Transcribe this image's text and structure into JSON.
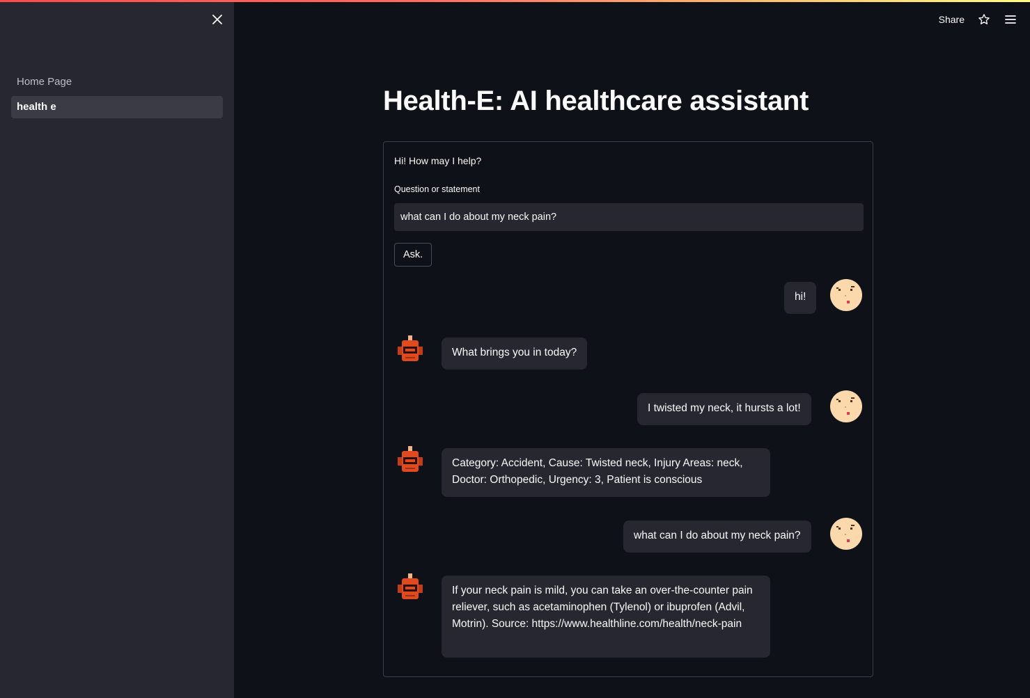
{
  "sidebar": {
    "items": [
      {
        "label": "Home Page",
        "active": false
      },
      {
        "label": "health e",
        "active": true
      }
    ]
  },
  "header": {
    "share_label": "Share",
    "icons": [
      "star-icon",
      "hamburger-menu-icon"
    ]
  },
  "main": {
    "title": "Health-E: AI healthcare assistant",
    "greeting": "Hi! How may I help?",
    "input_label": "Question or statement",
    "input_value": "what can I do about my neck pain?",
    "ask_label": "Ask.",
    "messages": [
      {
        "role": "user",
        "text": "hi!"
      },
      {
        "role": "bot",
        "text": "What brings you in today?"
      },
      {
        "role": "user",
        "text": "I twisted my neck, it hursts a lot!"
      },
      {
        "role": "bot",
        "text": "Category: Accident, Cause: Twisted neck, Injury Areas: neck, Doctor: Orthopedic, Urgency: 3, Patient is conscious"
      },
      {
        "role": "user",
        "text": "what can I do about my neck pain?"
      },
      {
        "role": "bot",
        "text": "If your neck pain is mild, you can take an over-the-counter pain reliever, such as acetaminophen (Tylenol) or ibuprofen (Advil, Motrin). Source: https://www.healthline.com/health/neck-pain"
      }
    ]
  },
  "colors": {
    "background": "#0e1117",
    "sidebar": "#262730",
    "bubble": "#262730",
    "accent": "#ff4b4b"
  }
}
